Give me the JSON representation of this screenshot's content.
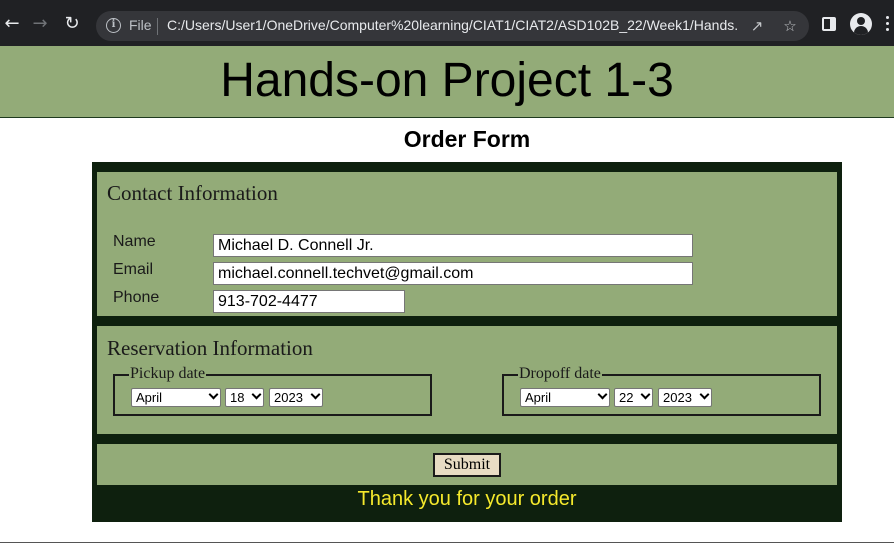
{
  "browser": {
    "back_icon": "back-arrow-icon",
    "forward_icon": "forward-arrow-icon",
    "reload_icon": "reload-icon",
    "file_label": "File",
    "url": "C:/Users/User1/OneDrive/Computer%20learning/CIAT1/CIAT2/ASD102B_22/Week1/Hands...",
    "colors": {
      "chrome": "#202124",
      "omnibox": "#35363a"
    }
  },
  "page": {
    "header_title": "Hands-on Project 1-3",
    "form_title": "Order Form",
    "colors": {
      "green": "#93ab78",
      "dark": "#0e200e",
      "thanks_yellow": "#f5e92c"
    }
  },
  "contact": {
    "legend": "Contact Information",
    "name_label": "Name",
    "name_value": "Michael D. Connell Jr.",
    "email_label": "Email",
    "email_value": "michael.connell.techvet@gmail.com",
    "phone_label": "Phone",
    "phone_value": "913-702-4477"
  },
  "reservation": {
    "legend": "Reservation Information",
    "pickup": {
      "legend": "Pickup date",
      "month": "April",
      "day": "18",
      "year": "2023"
    },
    "dropoff": {
      "legend": "Dropoff date",
      "month": "April",
      "day": "22",
      "year": "2023"
    }
  },
  "submit_label": "Submit",
  "thank_you": "Thank you for your order"
}
